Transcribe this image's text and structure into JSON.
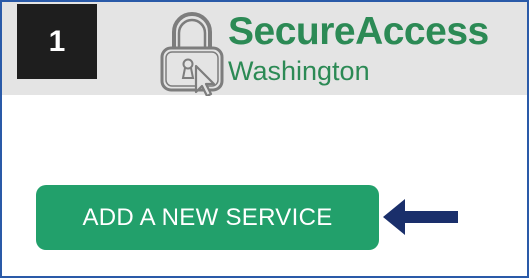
{
  "step": {
    "number": "1"
  },
  "brand": {
    "name": "SecureAccess",
    "subtitle": "Washington",
    "icon": "padlock-cursor-icon",
    "color": "#2c8a55"
  },
  "main": {
    "add_service_label": "ADD A NEW SERVICE",
    "button_color": "#22a06b"
  },
  "annotation": {
    "arrow_icon": "left-arrow-icon",
    "arrow_color": "#1a2f6b"
  }
}
